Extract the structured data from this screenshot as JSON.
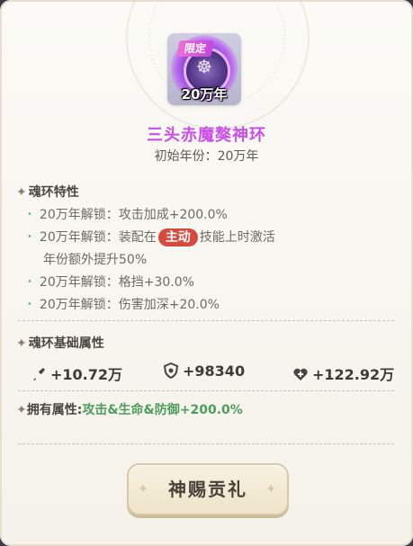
{
  "ring": {
    "limit_tag": "限定",
    "year_tag": "20万年",
    "name": "三头赤魔獒神环",
    "initial_year": "初始年份：20万年"
  },
  "traits": {
    "header": "魂环特性",
    "items": [
      {
        "prefix": "20万年解锁：",
        "text": "攻击加成+200.0%"
      },
      {
        "prefix": "20万年解锁：",
        "before": "装配在",
        "highlight": "主动",
        "after": "技能上时激活",
        "line2": "年份额外提升50%"
      },
      {
        "prefix": "20万年解锁：",
        "text": "格挡+30.0%"
      },
      {
        "prefix": "20万年解锁：",
        "text": "伤害加深+20.0%"
      }
    ]
  },
  "base_attrs": {
    "header": "魂环基础属性",
    "attack": "+10.72万",
    "defense": "+98340",
    "hp": "+122.92万"
  },
  "owned": {
    "label": "拥有属性:",
    "value": "攻击&生命&防御+200.0%"
  },
  "button": {
    "label": "神赐贡礼"
  },
  "colors": {
    "title": "#c94eea",
    "highlight_pill": "#d64a3e",
    "owned_value": "#4e9d5b",
    "bullet": "#6ab39a"
  },
  "icons": {
    "section_marker": "diamond-star-icon",
    "attack": "sword-icon",
    "defense": "shield-icon",
    "hp": "heart-icon"
  }
}
